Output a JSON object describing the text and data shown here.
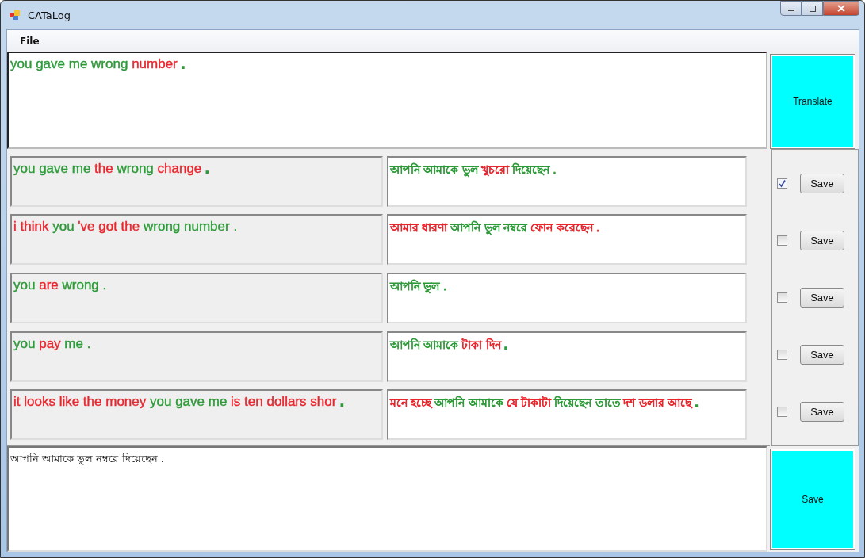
{
  "window": {
    "title": "CATaLog"
  },
  "menu": [
    "File"
  ],
  "input": {
    "segments": [
      {
        "text": "you gave me wrong",
        "color": "#2e9a3a"
      },
      {
        "text": "number",
        "color": "#e8262e"
      },
      {
        "text": ".",
        "color": "#2e9a3a"
      }
    ]
  },
  "translate_button": "Translate",
  "results": [
    {
      "source": [
        {
          "text": "you gave me",
          "color": "#2e9a3a"
        },
        {
          "text": "the",
          "color": "#e8262e"
        },
        {
          "text": "wrong",
          "color": "#2e9a3a"
        },
        {
          "text": "change",
          "color": "#e8262e"
        },
        {
          "text": ".",
          "color": "#2e9a3a"
        }
      ],
      "target": [
        {
          "text": "আপনি আমাকে ভুল",
          "color": "#2e9a3a"
        },
        {
          "text": "খুচরো",
          "color": "#e8262e"
        },
        {
          "text": "দিয়েছেন .",
          "color": "#2e9a3a"
        }
      ],
      "checked": true,
      "button": "Save"
    },
    {
      "source": [
        {
          "text": "i think",
          "color": "#e8262e"
        },
        {
          "text": "you",
          "color": "#2e9a3a"
        },
        {
          "text": "'ve got the",
          "color": "#e8262e"
        },
        {
          "text": "wrong number .",
          "color": "#2e9a3a"
        }
      ],
      "target": [
        {
          "text": "আমার ধারণা",
          "color": "#e8262e"
        },
        {
          "text": "আপনি ভুল নম্বরে",
          "color": "#2e9a3a"
        },
        {
          "text": "ফোন করেছেন .",
          "color": "#e8262e"
        }
      ],
      "checked": false,
      "button": "Save"
    },
    {
      "source": [
        {
          "text": "you",
          "color": "#2e9a3a"
        },
        {
          "text": "are",
          "color": "#e8262e"
        },
        {
          "text": "wrong .",
          "color": "#2e9a3a"
        }
      ],
      "target": [
        {
          "text": "আপনি ভুল .",
          "color": "#2e9a3a"
        }
      ],
      "checked": false,
      "button": "Save"
    },
    {
      "source": [
        {
          "text": "you",
          "color": "#2e9a3a"
        },
        {
          "text": "pay",
          "color": "#e8262e"
        },
        {
          "text": "me .",
          "color": "#2e9a3a"
        }
      ],
      "target": [
        {
          "text": "আপনি আমাকে",
          "color": "#2e9a3a"
        },
        {
          "text": "টাকা দিন",
          "color": "#e8262e"
        },
        {
          "text": ".",
          "color": "#2e9a3a"
        }
      ],
      "checked": false,
      "button": "Save"
    },
    {
      "source": [
        {
          "text": "it looks like the money",
          "color": "#e8262e"
        },
        {
          "text": "you gave me",
          "color": "#2e9a3a"
        },
        {
          "text": "is ten dollars shor",
          "color": "#e8262e"
        },
        {
          "text": ".",
          "color": "#2e9a3a"
        }
      ],
      "target": [
        {
          "text": "মনে হচ্ছে",
          "color": "#e8262e"
        },
        {
          "text": "আপনি আমাকে",
          "color": "#2e9a3a"
        },
        {
          "text": "যে টাকাটা",
          "color": "#e8262e"
        },
        {
          "text": "দিয়েছেন তাতে",
          "color": "#2e9a3a"
        },
        {
          "text": "দশ ডলার আছে",
          "color": "#e8262e"
        },
        {
          "text": ".",
          "color": "#2e9a3a"
        }
      ],
      "checked": false,
      "button": "Save"
    }
  ],
  "output": "আপনি আমাকে ভুল নম্বরে  দিয়েছেন .",
  "save_button": "Save"
}
